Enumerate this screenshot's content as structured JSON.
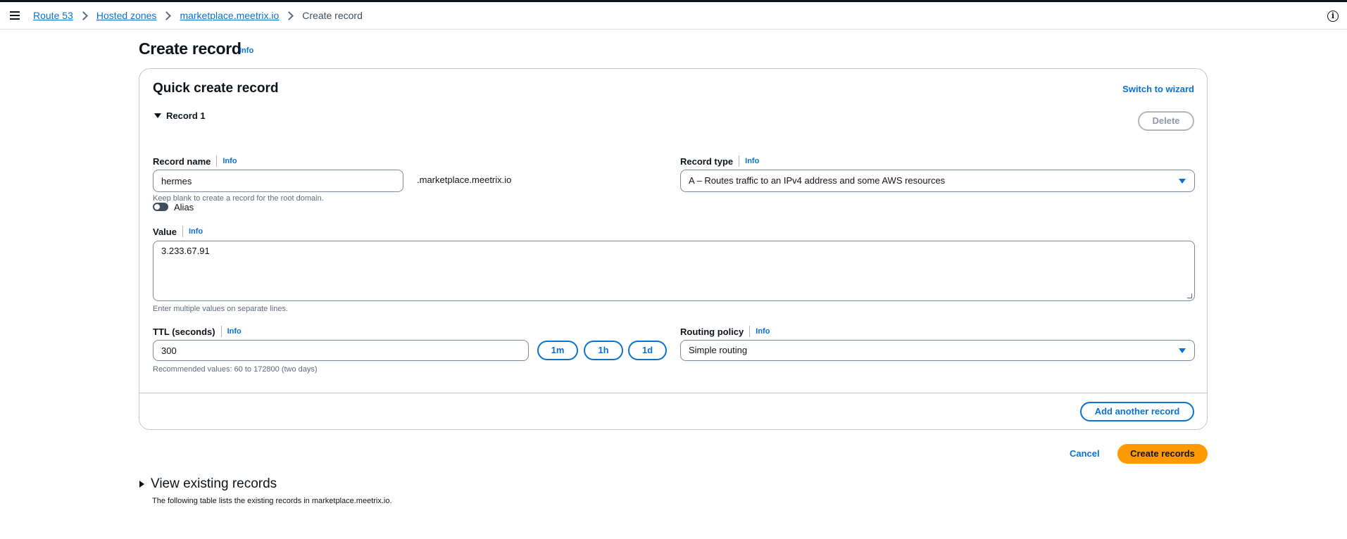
{
  "breadcrumbs": {
    "items": [
      "Route 53",
      "Hosted zones",
      "marketplace.meetrix.io"
    ],
    "current": "Create record"
  },
  "page": {
    "title": "Create record",
    "info": "Info"
  },
  "card": {
    "title": "Quick create record",
    "switch_wizard": "Switch to wizard",
    "record_header": "Record 1",
    "delete_label": "Delete",
    "add_another": "Add another record"
  },
  "record_name": {
    "label": "Record name",
    "info": "Info",
    "value": "hermes",
    "suffix": ".marketplace.meetrix.io",
    "hint": "Keep blank to create a record for the root domain."
  },
  "record_type": {
    "label": "Record type",
    "info": "Info",
    "selected": "A – Routes traffic to an IPv4 address and some AWS resources"
  },
  "alias": {
    "label": "Alias",
    "enabled": false
  },
  "value_field": {
    "label": "Value",
    "info": "Info",
    "value": "3.233.67.91",
    "hint": "Enter multiple values on separate lines."
  },
  "ttl": {
    "label": "TTL (seconds)",
    "info": "Info",
    "value": "300",
    "hint": "Recommended values: 60 to 172800 (two days)",
    "presets": [
      "1m",
      "1h",
      "1d"
    ]
  },
  "routing_policy": {
    "label": "Routing policy",
    "info": "Info",
    "selected": "Simple routing"
  },
  "actions": {
    "cancel": "Cancel",
    "create": "Create records"
  },
  "view_existing": {
    "title": "View existing records",
    "description": "The following table lists the existing records in marketplace.meetrix.io."
  },
  "icons": {
    "menu": "menu-icon",
    "help": "info-circle-icon",
    "breadcrumb_separator": "chevron-right-icon",
    "dropdown": "caret-down-icon"
  },
  "colors": {
    "link": "#0972d3",
    "primary_button": "#ff9900",
    "text": "#0f141a",
    "border": "#c6c6cd"
  }
}
